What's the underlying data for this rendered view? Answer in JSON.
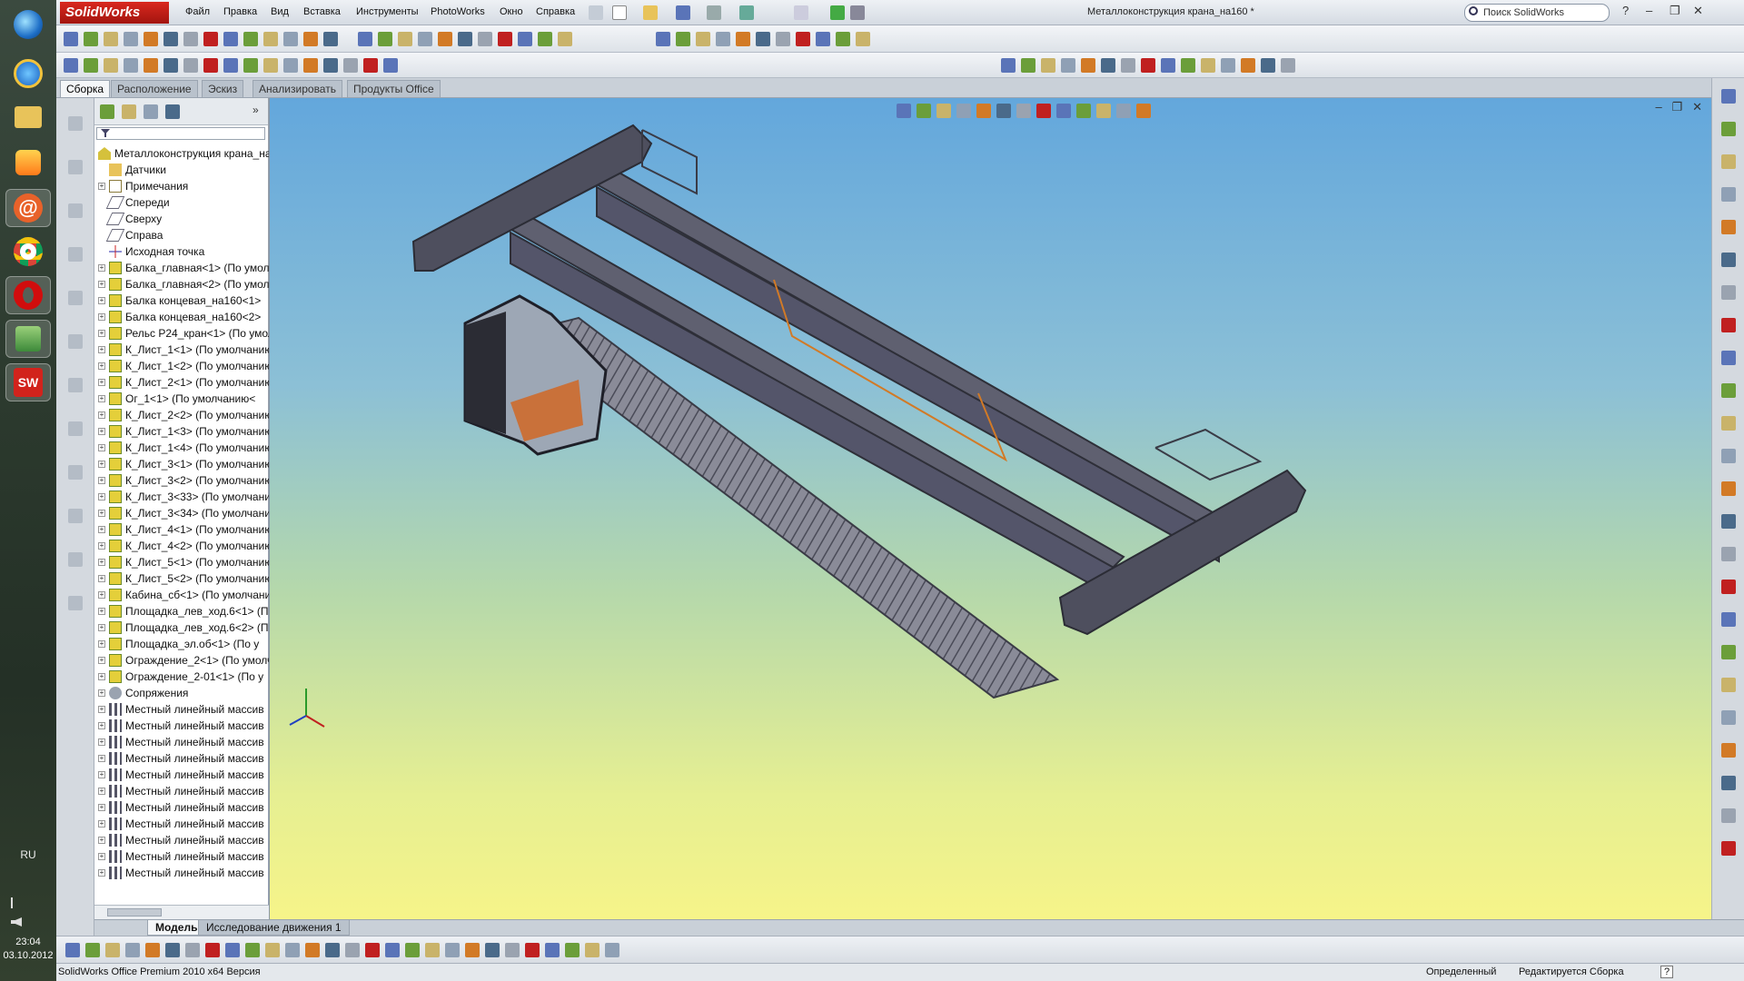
{
  "taskbar": {
    "language": "RU",
    "time": "23:04",
    "date": "03.10.2012"
  },
  "app": {
    "logo": "SolidWorks",
    "menu": [
      "Файл",
      "Правка",
      "Вид",
      "Вставка",
      "Инструменты",
      "PhotoWorks",
      "Окно",
      "Справка"
    ],
    "document_title": "Металлоконструкция крана_на160 *",
    "search_placeholder": "Поиск SolidWorks",
    "help_label": "?"
  },
  "command_tabs": [
    "Сборка",
    "Расположение",
    "Эскиз",
    "Анализировать",
    "Продукты Office"
  ],
  "feature_tree": {
    "root": "Металлоконструкция крана_на160",
    "items": [
      {
        "label": "Датчики",
        "icon": "folder-icon",
        "expand": false
      },
      {
        "label": "Примечания",
        "icon": "annotation-icon",
        "expand": true
      },
      {
        "label": "Спереди",
        "icon": "plane-icon",
        "expand": false
      },
      {
        "label": "Сверху",
        "icon": "plane-icon",
        "expand": false
      },
      {
        "label": "Справа",
        "icon": "plane-icon",
        "expand": false
      },
      {
        "label": "Исходная точка",
        "icon": "origin-icon",
        "expand": false
      },
      {
        "label": "Балка_главная<1> (По умолчанию)",
        "icon": "part-icon",
        "expand": true
      },
      {
        "label": "Балка_главная<2> (По умолчанию)",
        "icon": "part-icon",
        "expand": true
      },
      {
        "label": "Балка концевая_на160<1>",
        "icon": "part-icon",
        "expand": true
      },
      {
        "label": "Балка концевая_на160<2>",
        "icon": "part-icon",
        "expand": true
      },
      {
        "label": "Рельс Р24_кран<1> (По умолчанию)",
        "icon": "part-icon",
        "expand": true
      },
      {
        "label": "К_Лист_1<1> (По умолчанию)",
        "icon": "part-icon",
        "expand": true
      },
      {
        "label": "К_Лист_1<2> (По умолчанию)",
        "icon": "part-icon",
        "expand": true
      },
      {
        "label": "К_Лист_2<1> (По умолчанию)",
        "icon": "part-icon",
        "expand": true
      },
      {
        "label": "Ог_1<1> (По умолчанию<",
        "icon": "part-icon",
        "expand": true
      },
      {
        "label": "К_Лист_2<2> (По умолчанию)",
        "icon": "part-icon",
        "expand": true
      },
      {
        "label": "К_Лист_1<3> (По умолчанию)",
        "icon": "part-icon",
        "expand": true
      },
      {
        "label": "К_Лист_1<4> (По умолчанию)",
        "icon": "part-icon",
        "expand": true
      },
      {
        "label": "К_Лист_3<1> (По умолчанию)",
        "icon": "part-icon",
        "expand": true
      },
      {
        "label": "К_Лист_3<2> (По умолчанию)",
        "icon": "part-icon",
        "expand": true
      },
      {
        "label": "К_Лист_3<33> (По умолчанию)",
        "icon": "part-icon",
        "expand": true
      },
      {
        "label": "К_Лист_3<34> (По умолчанию)",
        "icon": "part-icon",
        "expand": true
      },
      {
        "label": "К_Лист_4<1> (По умолчанию)",
        "icon": "part-icon",
        "expand": true
      },
      {
        "label": "К_Лист_4<2> (По умолчанию)",
        "icon": "part-icon",
        "expand": true
      },
      {
        "label": "К_Лист_5<1> (По умолчанию)",
        "icon": "part-icon",
        "expand": true
      },
      {
        "label": "К_Лист_5<2> (По умолчанию)",
        "icon": "part-icon",
        "expand": true
      },
      {
        "label": "Кабина_сб<1> (По умолчанию)",
        "icon": "part-icon",
        "expand": true
      },
      {
        "label": "Площадка_лев_ход.6<1> (По",
        "icon": "part-icon",
        "expand": true
      },
      {
        "label": "Площадка_лев_ход.6<2> (По",
        "icon": "part-icon",
        "expand": true
      },
      {
        "label": "Площадка_эл.об<1> (По у",
        "icon": "part-icon",
        "expand": true
      },
      {
        "label": "Ограждение_2<1> (По умолчанию)",
        "icon": "part-icon",
        "expand": true
      },
      {
        "label": "Ограждение_2-01<1> (По у",
        "icon": "part-icon",
        "expand": true
      },
      {
        "label": "Сопряжения",
        "icon": "mates-icon",
        "expand": true
      },
      {
        "label": "Местный линейный массив",
        "icon": "pattern-icon",
        "expand": true
      },
      {
        "label": "Местный линейный массив",
        "icon": "pattern-icon",
        "expand": true
      },
      {
        "label": "Местный линейный массив",
        "icon": "pattern-icon",
        "expand": true
      },
      {
        "label": "Местный линейный массив",
        "icon": "pattern-icon",
        "expand": true
      },
      {
        "label": "Местный линейный массив",
        "icon": "pattern-icon",
        "expand": true
      },
      {
        "label": "Местный линейный массив",
        "icon": "pattern-icon",
        "expand": true
      },
      {
        "label": "Местный линейный массив",
        "icon": "pattern-icon",
        "expand": true
      },
      {
        "label": "Местный линейный массив",
        "icon": "pattern-icon",
        "expand": true
      },
      {
        "label": "Местный линейный массив",
        "icon": "pattern-icon",
        "expand": true
      },
      {
        "label": "Местный линейный массив",
        "icon": "pattern-icon",
        "expand": true
      },
      {
        "label": "Местный линейный массив",
        "icon": "pattern-icon",
        "expand": true
      }
    ]
  },
  "bottom_tabs": [
    "Модель",
    "Исследование движения 1"
  ],
  "status": {
    "product": "SolidWorks Office Premium 2010 x64 Версия",
    "state": "Определенный",
    "mode": "Редактируется Сборка",
    "help": "?"
  },
  "colors": {
    "accent": "#c8261a",
    "viewport_top": "#63a7dc",
    "viewport_bottom": "#f6f489",
    "beam": "#55566a"
  }
}
